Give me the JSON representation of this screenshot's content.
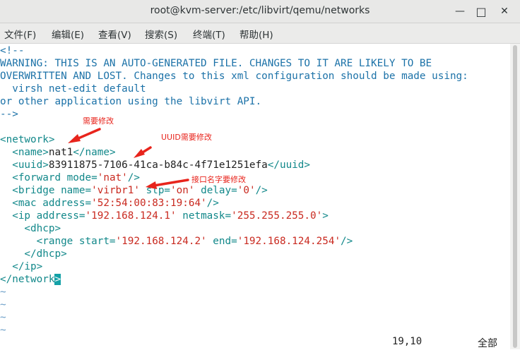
{
  "window": {
    "title": "root@kvm-server:/etc/libvirt/qemu/networks",
    "controls": {
      "minimize": "—",
      "maximize": "□",
      "close": "✕"
    }
  },
  "menu": [
    {
      "label": "文件(F)"
    },
    {
      "label": "编辑(E)"
    },
    {
      "label": "查看(V)"
    },
    {
      "label": "搜索(S)"
    },
    {
      "label": "终端(T)"
    },
    {
      "label": "帮助(H)"
    }
  ],
  "editor": {
    "comment": [
      "<!--",
      "WARNING: THIS IS AN AUTO-GENERATED FILE. CHANGES TO IT ARE LIKELY TO BE",
      "OVERWRITTEN AND LOST. Changes to this xml configuration should be made using:",
      "  virsh net-edit default",
      "or other application using the libvirt API.",
      "-->"
    ],
    "xml": {
      "network_open": "<network>",
      "name_open": "  <name>",
      "name_value": "nat1",
      "name_close": "</name>",
      "uuid_open": "  <uuid>",
      "uuid_value": "83911875-7106-41ca-b84c-4f71e1251efa",
      "uuid_close": "</uuid>",
      "forward_pre": "  <forward mode=",
      "forward_val": "'nat'",
      "forward_post": "/>",
      "bridge_pre": "  <bridge name=",
      "bridge_name_val": "'virbr1'",
      "bridge_stp_attr": " stp=",
      "bridge_stp_val": "'on'",
      "bridge_delay_attr": " delay=",
      "bridge_delay_val": "'0'",
      "bridge_post": "/>",
      "mac_pre": "  <mac address=",
      "mac_val": "'52:54:00:83:19:64'",
      "mac_post": "/>",
      "ip_pre": "  <ip address=",
      "ip_val": "'192.168.124.1'",
      "ip_netmask_attr": " netmask=",
      "ip_netmask_val": "'255.255.255.0'",
      "ip_post": ">",
      "dhcp_open": "    <dhcp>",
      "range_pre": "      <range start=",
      "range_start_val": "'192.168.124.2'",
      "range_end_attr": " end=",
      "range_end_val": "'192.168.124.254'",
      "range_post": "/>",
      "dhcp_close": "    </dhcp>",
      "ip_close": "  </ip>",
      "network_close_text": "</network",
      "network_close_cursor": ">"
    },
    "tildes": [
      "~",
      "~",
      "~",
      "~"
    ],
    "status": {
      "position": "19,10",
      "scope": "全部"
    }
  },
  "annotations": [
    {
      "text": "需要修改"
    },
    {
      "text": "UUID需要修改"
    },
    {
      "text": "接口名字要修改"
    }
  ],
  "colors": {
    "keyword": "#1c72a8",
    "tag": "#12888a",
    "string": "#c92a20",
    "cursor": "#14a1a7",
    "annotation": "#e8241c"
  }
}
